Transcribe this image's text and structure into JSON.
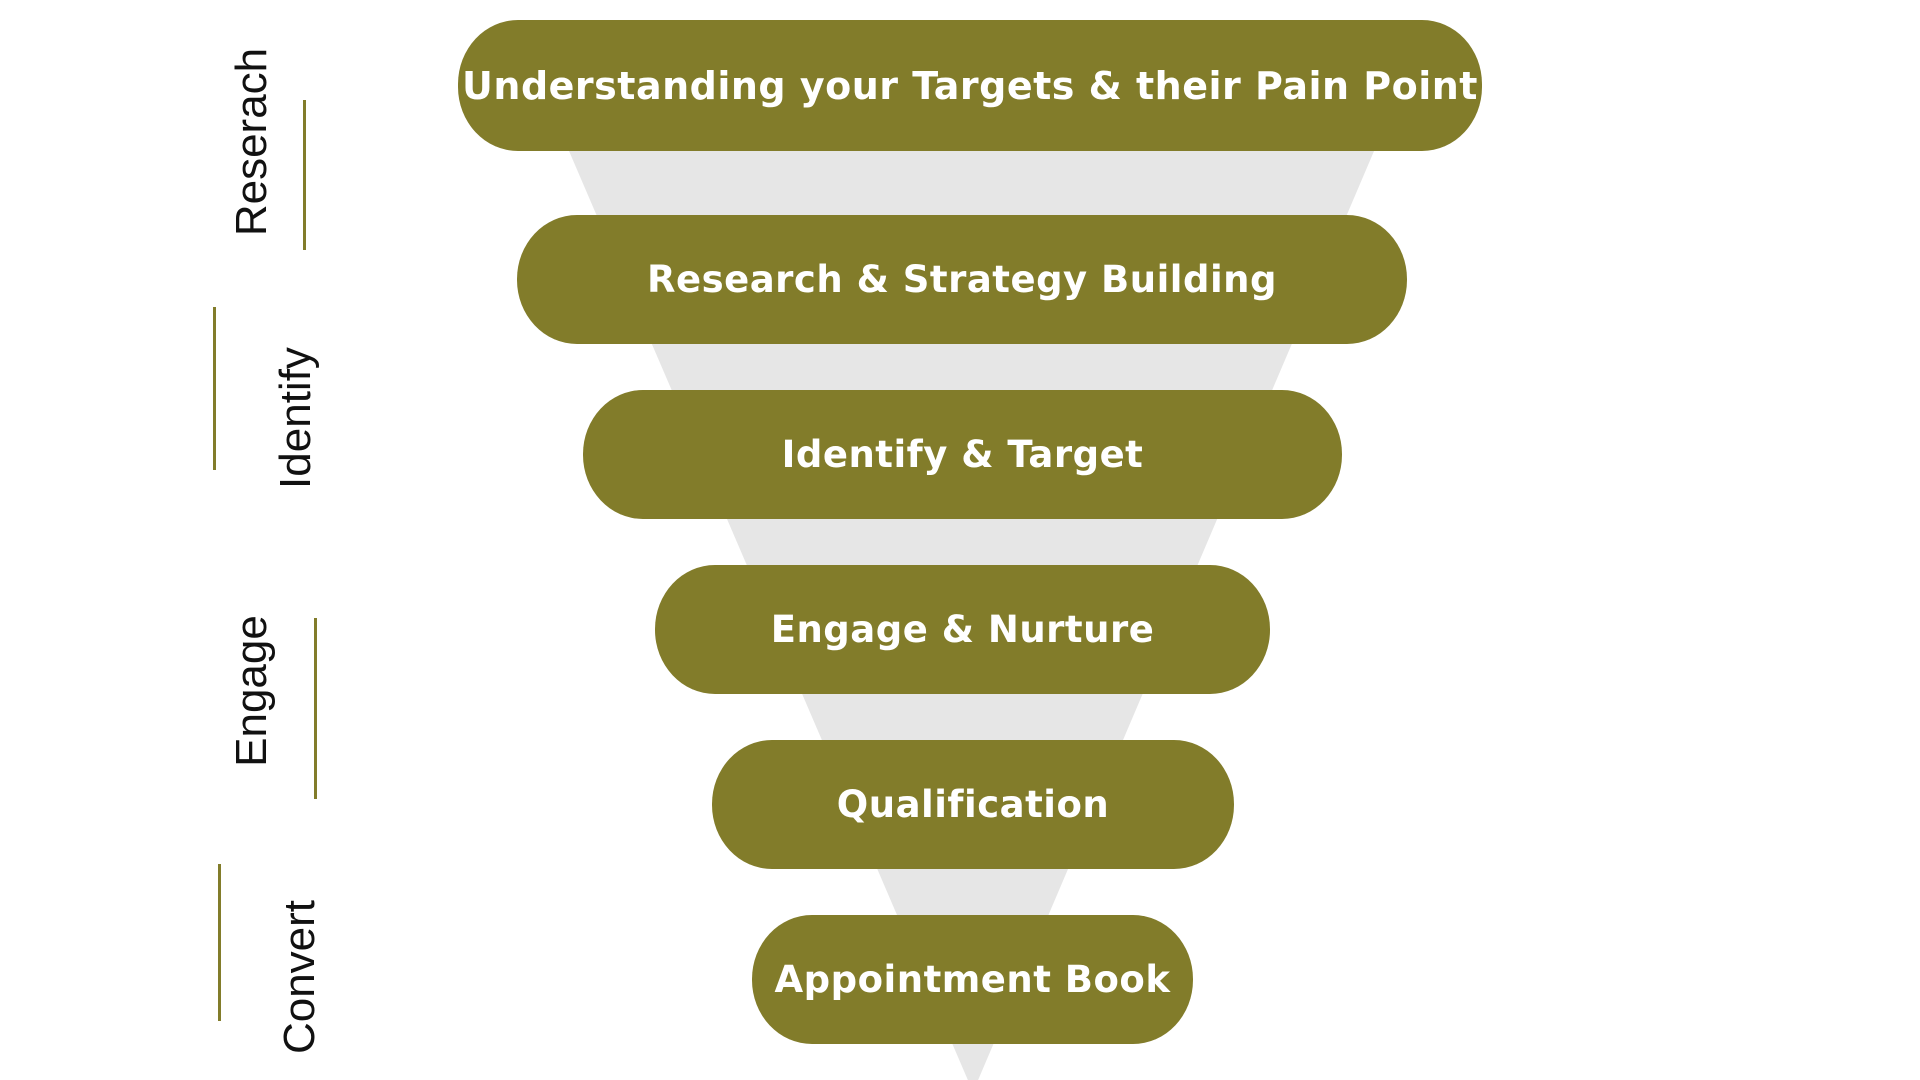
{
  "funnel": {
    "stages": [
      {
        "label": "Understanding your Targets & their Pain Point"
      },
      {
        "label": "Research & Strategy Building"
      },
      {
        "label": "Identify & Target"
      },
      {
        "label": "Engage & Nurture"
      },
      {
        "label": "Qualification"
      },
      {
        "label": "Appointment Book"
      }
    ]
  },
  "phases": [
    {
      "label": "Reserach"
    },
    {
      "label": "Identify"
    },
    {
      "label": "Engage"
    },
    {
      "label": "Convert"
    }
  ],
  "colors": {
    "pill": "#827c2a",
    "funnel_shadow": "#e6e6e6",
    "accent_line": "#827c2a",
    "pill_text": "#ffffff",
    "label_text": "#111111"
  }
}
